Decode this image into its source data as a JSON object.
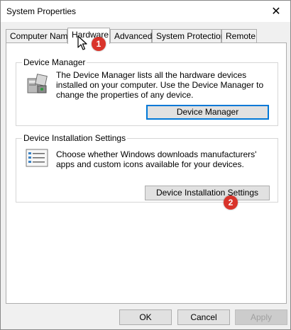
{
  "window": {
    "title": "System Properties",
    "close_glyph": "✕"
  },
  "tabs": [
    {
      "label": "Computer Name",
      "active": false
    },
    {
      "label": "Hardware",
      "active": true
    },
    {
      "label": "Advanced",
      "active": false
    },
    {
      "label": "System Protection",
      "active": false
    },
    {
      "label": "Remote",
      "active": false
    }
  ],
  "device_manager": {
    "group_label": "Device Manager",
    "description": "The Device Manager lists all the hardware devices installed on your computer. Use the Device Manager to change the properties of any device.",
    "button_label": "Device Manager",
    "icon": "device-manager-icon"
  },
  "device_installation": {
    "group_label": "Device Installation Settings",
    "description": "Choose whether Windows downloads manufacturers' apps and custom icons available for your devices.",
    "button_label": "Device Installation Settings",
    "icon": "checklist-icon"
  },
  "footer": {
    "ok_label": "OK",
    "cancel_label": "Cancel",
    "apply_label": "Apply"
  },
  "annotations": {
    "step1": "1",
    "step2": "2",
    "badge_color": "#d9342b"
  },
  "colors": {
    "focus_accent": "#0078d7",
    "window_bg": "#f0f0f0",
    "panel_bg": "#ffffff"
  }
}
